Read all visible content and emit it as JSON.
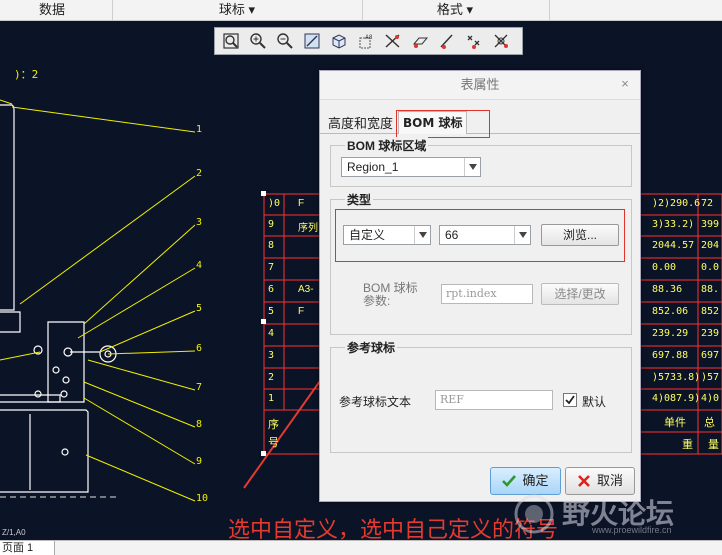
{
  "topbar": {
    "col1": "数据",
    "col2": "球标 ▾",
    "col3": "格式 ▾"
  },
  "toolbar": {
    "icons": [
      "zoom-window-icon",
      "zoom-in-icon",
      "zoom-out-icon",
      "refit-icon",
      "display-style-icon",
      "spin-center-icon",
      "datum-display-icon",
      "plane-display-icon",
      "axis-display-icon",
      "point-display-icon",
      "csys-display-icon"
    ]
  },
  "drawing": {
    "left_label": ")：2",
    "balloons": [
      "1",
      "2",
      "3",
      "4",
      "5",
      "6",
      "7",
      "8",
      "9",
      "10"
    ],
    "table_left_col": [
      ")0",
      "9",
      "8",
      "7",
      "6",
      "5",
      "4",
      "3",
      "2",
      "1"
    ],
    "table_left_text": [
      "F",
      "序列",
      "",
      "",
      "A3-",
      "F",
      "",
      "",
      "",
      ""
    ],
    "table_left_footer": [
      "序",
      "号"
    ],
    "table_right_col": [
      ")2)290.6",
      "3)33.2)",
      "2044.57",
      "0.00",
      "88.36",
      "852.06",
      "239.29",
      "697.88",
      ")5733.8)",
      "4)087.9)"
    ],
    "table_right_col2": [
      "72",
      "399",
      "204",
      "0.0",
      "88.",
      "852",
      "239",
      "697",
      ")57",
      "4)0"
    ],
    "table_right_footer": [
      "单件",
      "总",
      "重",
      "量"
    ],
    "page_label": "页面 1",
    "coord_label": "Z/1,A0"
  },
  "dialog": {
    "title": "表属性",
    "close": "×",
    "tab1": "高度和宽度",
    "tab2": "BOM 球标",
    "region_group": "BOM 球标区域",
    "region_value": "Region_1",
    "type_group": "类型",
    "type_value": "自定义",
    "number_value": "66",
    "browse_btn": "浏览...",
    "param_label": "BOM 球标参数:",
    "param_value": "rpt.index",
    "select_btn": "选择/更改",
    "ref_group": "参考球标",
    "ref_label": "参考球标文本",
    "ref_value": "REF",
    "default_label": "默认",
    "default_checked": true,
    "ok_btn": "确定",
    "cancel_btn": "取消"
  },
  "annotation": "选中自定义，选中自己定义的符号",
  "watermark": {
    "text": "野火论坛",
    "url": "www.proewildfire.cn"
  },
  "colors": {
    "drawing_line": "#f0f000",
    "table_line": "#ff3030",
    "annotation": "#e53a2f"
  }
}
